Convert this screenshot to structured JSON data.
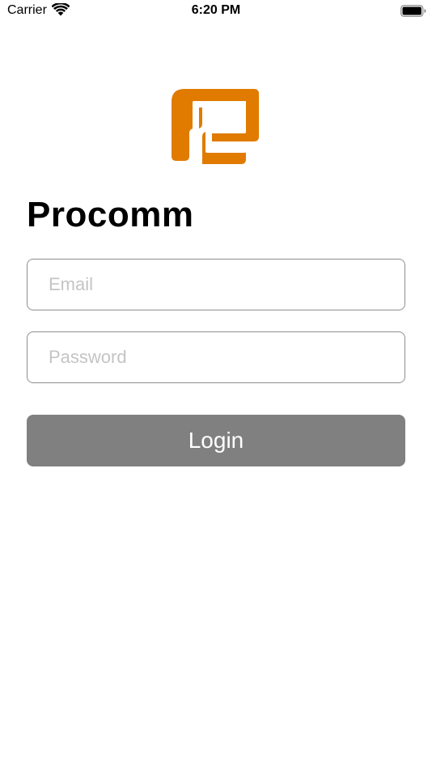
{
  "status_bar": {
    "carrier": "Carrier",
    "time": "6:20 PM",
    "wifi_icon": "wifi-icon",
    "battery_icon": "battery-full-icon"
  },
  "logo": {
    "icon": "procomm-logo",
    "color": "#E07B00"
  },
  "app": {
    "title": "Procomm"
  },
  "form": {
    "email_placeholder": "Email",
    "email_value": "",
    "password_placeholder": "Password",
    "password_value": "",
    "login_label": "Login",
    "login_button_color": "#808080"
  }
}
